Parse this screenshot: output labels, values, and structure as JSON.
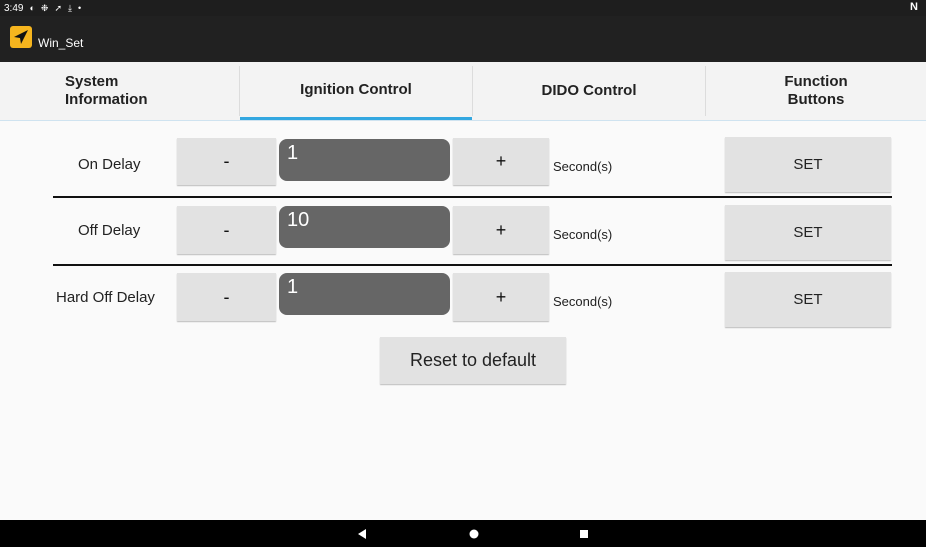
{
  "status_bar": {
    "time": "3:49",
    "icons": [
      "notification-icon",
      "settings-icon",
      "location-icon",
      "download-icon",
      "dot-icon"
    ],
    "nfc_label": "N"
  },
  "app": {
    "title": "Win_Set",
    "icon_color": "#f6b51e"
  },
  "tabs": [
    {
      "label": "System Information",
      "selected": false
    },
    {
      "label": "Ignition Control",
      "selected": true
    },
    {
      "label": "DIDO Control",
      "selected": false
    },
    {
      "label": "Function Buttons",
      "selected": false
    }
  ],
  "rows": [
    {
      "label": "On Delay",
      "minus": "-",
      "value": "1",
      "plus": "+",
      "unit": "Second(s)",
      "set": "SET"
    },
    {
      "label": "Off Delay",
      "minus": "-",
      "value": "10",
      "plus": "+",
      "unit": "Second(s)",
      "set": "SET"
    },
    {
      "label": "Hard Off Delay",
      "minus": "-",
      "value": "1",
      "plus": "+",
      "unit": "Second(s)",
      "set": "SET"
    }
  ],
  "reset_label": "Reset to default",
  "nav": [
    "back-icon",
    "home-icon",
    "recents-icon"
  ],
  "colors": {
    "accent": "#33a7e0",
    "field_bg": "#666666",
    "button_bg": "#e2e2e2"
  }
}
